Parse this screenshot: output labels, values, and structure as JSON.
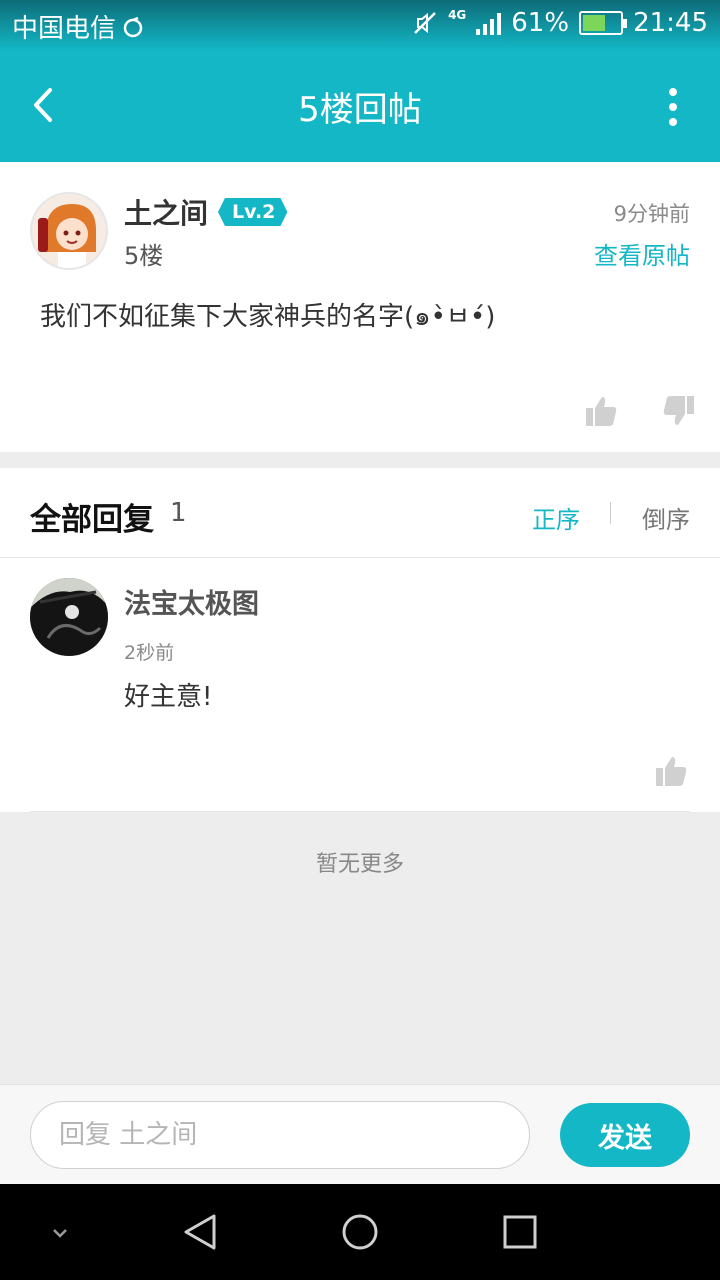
{
  "status_bar": {
    "carrier": "中国电信",
    "network": "4G",
    "battery": "61%",
    "battery_level": 0.61,
    "time": "21:45"
  },
  "header": {
    "title": "5楼回帖",
    "back_icon": "chevron-left-icon",
    "more_icon": "more-vertical-icon"
  },
  "post": {
    "author": "土之间",
    "level": "Lv.2",
    "floor": "5楼",
    "time": "9分钟前",
    "view_original": "查看原帖",
    "content": "我们不如征集下大家神兵的名字(๑•̀ㅂ•́)",
    "icons": [
      "thumb-up-icon",
      "thumb-down-icon"
    ]
  },
  "replies": {
    "title": "全部回复",
    "count": "1",
    "sort_asc": "正序",
    "sort_desc": "倒序",
    "items": [
      {
        "author": "法宝太极图",
        "time": "2秒前",
        "content": "好主意!"
      }
    ],
    "no_more": "暂无更多"
  },
  "input_bar": {
    "placeholder": "回复 土之间",
    "send": "发送"
  },
  "colors": {
    "accent": "#13b7c6",
    "background": "#ededed"
  }
}
